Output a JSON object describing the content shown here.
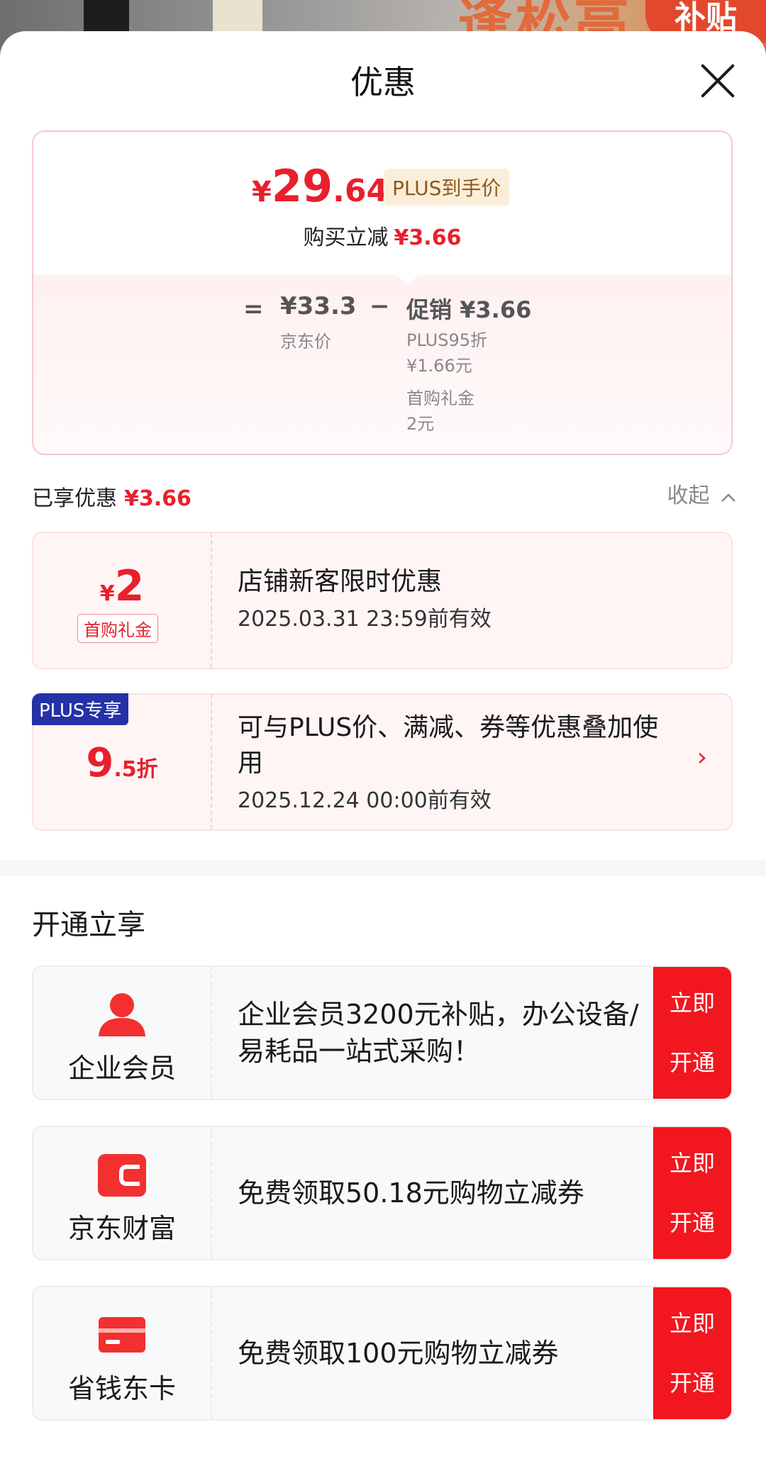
{
  "backdrop": {
    "big_text": "逢松高",
    "tag": "补贴"
  },
  "header": {
    "title": "优惠"
  },
  "price": {
    "yen": "¥",
    "int": "29",
    "dec": ".64",
    "plus_badge": "PLUS到手价",
    "reduce_label": "购买立减",
    "reduce_value": "¥3.66",
    "equals": "=",
    "jd_price": "¥33.3",
    "jd_label": "京东价",
    "minus": "−",
    "promo_head": "促销 ¥3.66",
    "promo_lines": [
      "PLUS95折",
      "¥1.66元",
      "首购礼金",
      "2元"
    ]
  },
  "enjoyed": {
    "label": "已享优惠",
    "value": "¥3.66",
    "collapse": "收起"
  },
  "coupons": [
    {
      "yen": "¥",
      "amount": "2",
      "tag": "首购礼金",
      "title": "店铺新客限时优惠",
      "validity": "2025.03.31 23:59前有效"
    },
    {
      "plus_tag": "PLUS专享",
      "disc_big": "9",
      "disc_small": ".5折",
      "title": "可与PLUS价、满减、券等优惠叠加使用",
      "validity": "2025.12.24 00:00前有效"
    }
  ],
  "section": {
    "title": "开通立享"
  },
  "members": [
    {
      "name": "企业会员",
      "icon": "person-icon",
      "desc": "企业会员3200元补贴，办公设备/易耗品一站式采购！",
      "btn_line1": "立即",
      "btn_line2": "开通"
    },
    {
      "name": "京东财富",
      "icon": "wallet-icon",
      "desc": "免费领取50.18元购物立减券",
      "btn_line1": "立即",
      "btn_line2": "开通"
    },
    {
      "name": "省钱东卡",
      "icon": "card-icon",
      "desc": "免费领取100元购物立减券",
      "btn_line1": "立即",
      "btn_line2": "开通"
    }
  ],
  "colors": {
    "accent": "#e8202d",
    "button": "#f2161f",
    "plus_blue": "#2432a6"
  }
}
